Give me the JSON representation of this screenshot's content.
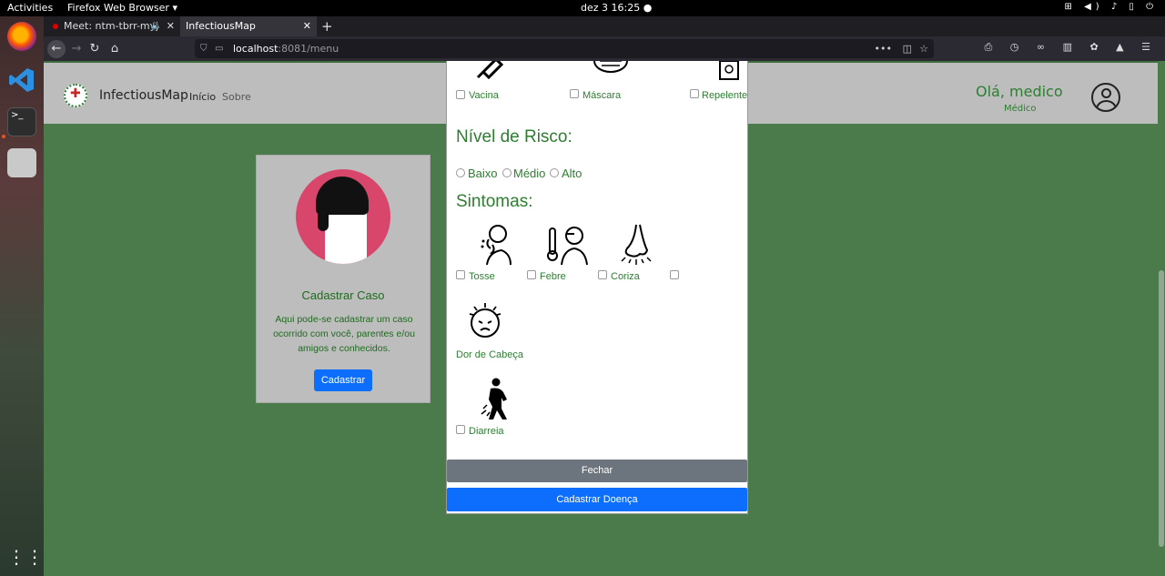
{
  "desktop": {
    "activities": "Activities",
    "app_menu": "Firefox Web Browser ▾",
    "clock": "dez 3  16:25  ●"
  },
  "browser": {
    "tabs": [
      {
        "label": "Meet: ntm-tbrr-myj"
      },
      {
        "label": "InfectiousMap"
      }
    ],
    "url_host": "localhost",
    "url_path": ":8081/menu"
  },
  "navbar": {
    "brand": "InfectiousMap",
    "links": [
      "Início",
      "Sobre"
    ],
    "greeting": "Olá, medico",
    "role": "Médico"
  },
  "card": {
    "title": "Cadastrar Caso",
    "text": "Aqui pode-se cadastrar um caso ocorrido com você, parentes e/ou amigos e conhecidos.",
    "button": "Cadastrar"
  },
  "modal": {
    "prevention": [
      "Vacina",
      "Máscara",
      "Repelente"
    ],
    "risk_heading": "Nível de Risco:",
    "risk_options": [
      "Baixo",
      "Médio",
      "Alto"
    ],
    "symptoms_heading": "Sintomas:",
    "symptoms": [
      "Tosse",
      "Febre",
      "Coriza",
      "Dor de Cabeça",
      "Diarreia"
    ],
    "close_button": "Fechar",
    "submit_button": "Cadastrar Doença"
  }
}
